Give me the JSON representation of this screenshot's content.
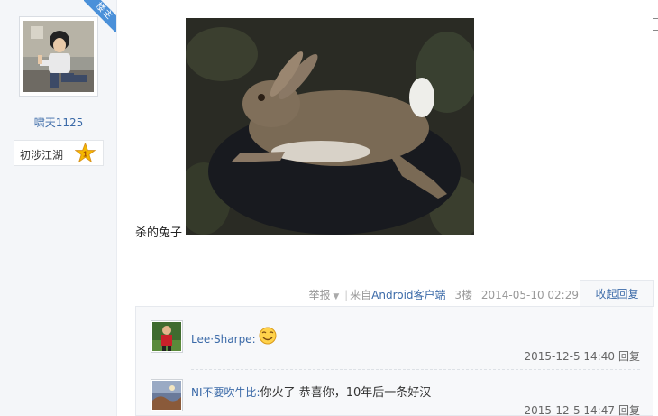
{
  "sidebar": {
    "badge": "楼主",
    "username": "啸天1125",
    "level_title": "初涉江湖",
    "level_number": "1"
  },
  "post": {
    "text": "杀的兔子"
  },
  "meta": {
    "report": "举报",
    "from_prefix": "来自",
    "client": "Android客户端",
    "floor": "3楼",
    "datetime": "2014-05-10 02:29",
    "collapse": "收起回复"
  },
  "replies": [
    {
      "user": "Lee·Sharpe:",
      "content": "",
      "emoji": "smiley-emoji",
      "time": "2015-12-5 14:40",
      "reply_label": "回复"
    },
    {
      "user": "NI不要吹牛比:",
      "content": "你火了 恭喜你，10年后一条好汉",
      "time": "2015-12-5 14:47",
      "reply_label": "回复"
    }
  ],
  "colors": {
    "link": "#3b6aa8",
    "sidebar_bg": "#f4f6f9",
    "badge": "#4a90d9",
    "level_star": "#f5b800"
  }
}
